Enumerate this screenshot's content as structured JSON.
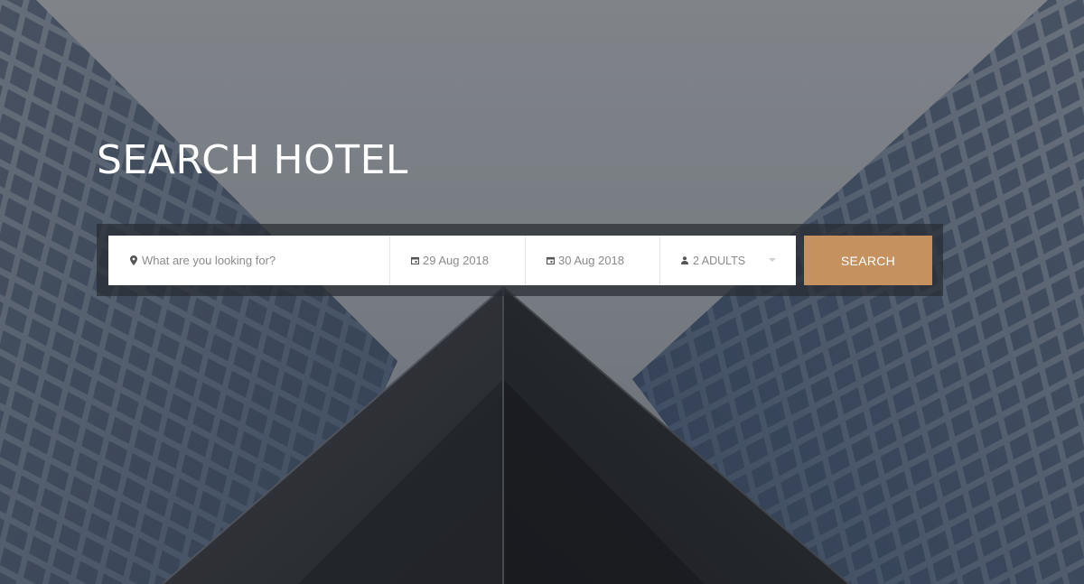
{
  "hero": {
    "title": "SEARCH HOTEL"
  },
  "search": {
    "keyword_placeholder": "What are you looking for?",
    "keyword_value": "",
    "checkin_date": "29 Aug 2018",
    "checkout_date": "30 Aug 2018",
    "guests": "2 ADULTS",
    "button_label": "SEARCH"
  },
  "icons": {
    "location": "map-pin-icon",
    "checkin": "calendar-icon",
    "checkout": "calendar-icon",
    "guests": "person-icon",
    "dropdown": "chevron-down-icon"
  },
  "colors": {
    "accent": "#c4915f",
    "bar_background": "#2a2d32",
    "field_background": "#ffffff",
    "field_text": "#8a8a8a"
  }
}
